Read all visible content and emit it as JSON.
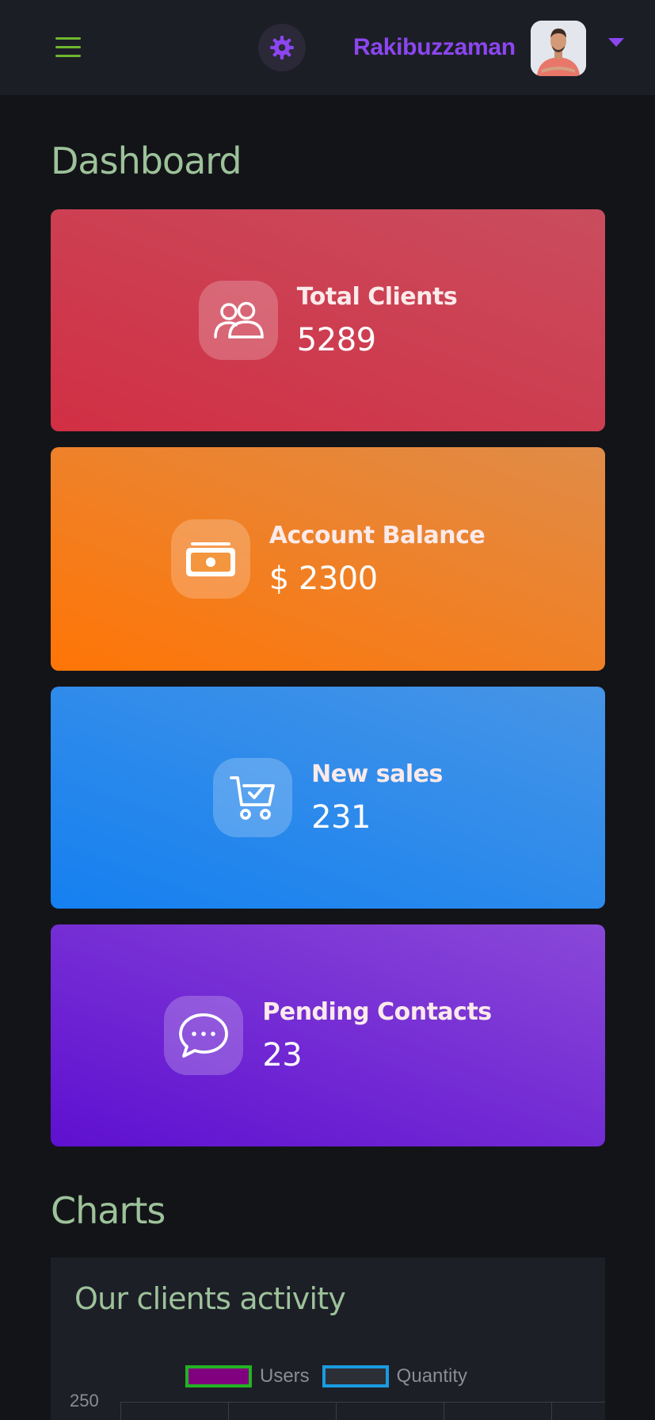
{
  "header": {
    "username": "Rakibuzzaman",
    "menu_icon": "hamburger-menu-icon",
    "theme_icon": "gear-icon",
    "dropdown_icon": "caret-down-icon",
    "accent_color": "#8c46f0"
  },
  "dashboard": {
    "title": "Dashboard",
    "cards": [
      {
        "label": "Total Clients",
        "value": "5289",
        "icon": "users-icon",
        "color": "#d12f44"
      },
      {
        "label": "Account Balance",
        "value": "$ 2300",
        "icon": "money-icon",
        "color": "#ff7506"
      },
      {
        "label": "New sales",
        "value": "231",
        "icon": "cart-check-icon",
        "color": "#1580f0"
      },
      {
        "label": "Pending Contacts",
        "value": "23",
        "icon": "chat-bubble-icon",
        "color": "#5e10d0"
      }
    ]
  },
  "charts": {
    "title": "Charts",
    "panel_title": "Our clients activity",
    "chart_data": {
      "type": "bar",
      "series": [
        {
          "name": "Users",
          "color": "#800080",
          "border": "#22b322"
        },
        {
          "name": "Quantity",
          "color": "#2c2f36",
          "border": "#1a9be0"
        }
      ],
      "y_tick_top": "250"
    }
  }
}
